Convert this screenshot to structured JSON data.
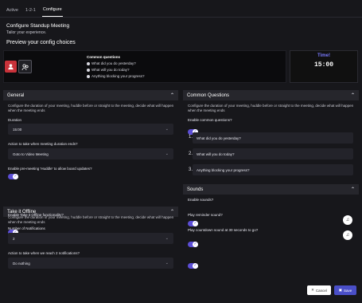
{
  "tabs": [
    {
      "label": "Active"
    },
    {
      "label": "1-2-1"
    },
    {
      "label": "Configure"
    }
  ],
  "page": {
    "title": "Configure Standup Meeting",
    "subtitle": "Tailor your experience.",
    "preview_title": "Preview your config choices"
  },
  "preview": {
    "questions_title": "Common questions",
    "questions": [
      "What did you do yesterday?",
      "What will you do today?",
      "Anything blocking your progress?"
    ],
    "timer_label": "Time!",
    "timer_value": "15:00"
  },
  "general": {
    "title": "General",
    "description": "Configure the duration of your meeting, huddle before or straight to the meeting, decide what will happen when the meeting ends",
    "duration_label": "Duration",
    "duration_value": "15:00",
    "action_label": "Action to take when meeting duration ends?",
    "action_value": "Goto to Video Meeting",
    "huddle_label": "Enable pre-meeting 'Huddle' to allow board updates?",
    "huddle_enabled": true
  },
  "common_questions": {
    "title": "Common Questions",
    "description": "Configure the duration of your meeting, huddle before or straight to the meeting, decide what will happen when the meeting ends",
    "enable_label": "Enable common questions?",
    "enabled": true,
    "items": [
      {
        "num": "1.",
        "text": "What did you do yesterday?"
      },
      {
        "num": "2.",
        "text": "What will you do today?"
      },
      {
        "num": "3.",
        "text": "Anything blocking your progress?"
      }
    ]
  },
  "offline": {
    "title": "Take it Offline",
    "description": "Configure the duration of your meeting, huddle before or straight to the meeting, decide what will happen when the meeting ends",
    "enable_label": "Enable Take it Offline functionality?",
    "enabled": true,
    "notifications_label": "Number of Notifications",
    "notifications_value": "2",
    "action_label": "Action to take when we reach 2 notifications?",
    "action_value": "Do nothing"
  },
  "sounds": {
    "title": "Sounds",
    "enable_label": "Enable sounds?",
    "enabled": true,
    "reminder_label": "Play reminder sound?",
    "reminder_enabled": true,
    "countdown_label": "Play countdown sound at 30 seconds to go?",
    "countdown_enabled": true
  },
  "actions": {
    "cancel": "Cancel",
    "save": "Save"
  },
  "colors": {
    "accent": "#5c4ed6",
    "save_button": "#4a4fc8",
    "background": "#17171b"
  }
}
